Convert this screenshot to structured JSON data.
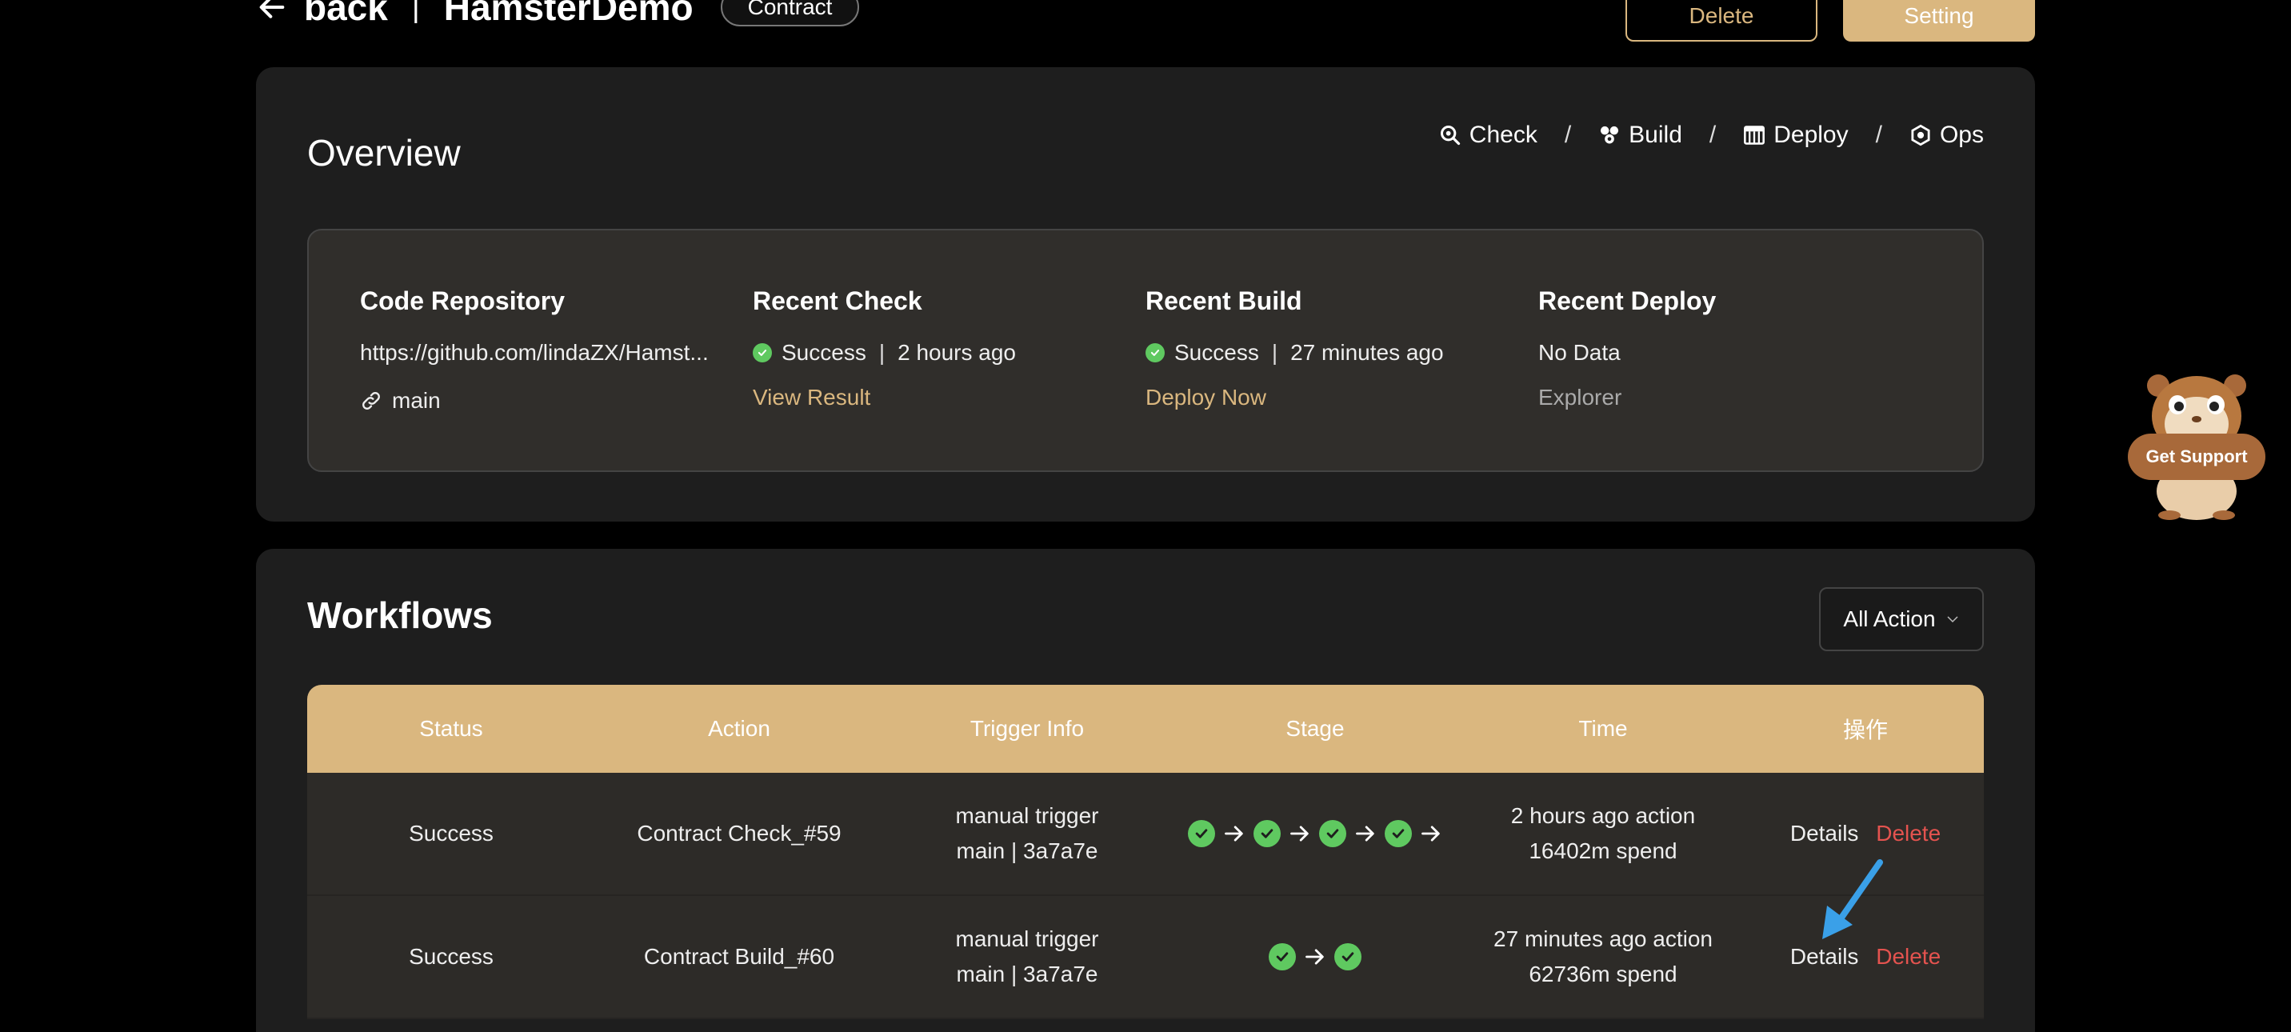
{
  "header": {
    "back_label": "back",
    "separator": "|",
    "project_name": "HamsterDemo",
    "project_type_tag": "Contract",
    "delete_label": "Delete",
    "setting_label": "Setting"
  },
  "overview": {
    "title": "Overview",
    "nav": [
      {
        "label": "Check",
        "icon": "search-icon"
      },
      {
        "label": "Build",
        "icon": "build-icon"
      },
      {
        "label": "Deploy",
        "icon": "deploy-icon"
      },
      {
        "label": "Ops",
        "icon": "ops-icon"
      }
    ],
    "nav_separator": "/",
    "code_repository": {
      "title": "Code Repository",
      "url": "https://github.com/lindaZX/Hamst...",
      "branch": "main"
    },
    "recent_check": {
      "title": "Recent Check",
      "status": "Success",
      "time": "2 hours ago",
      "link": "View Result"
    },
    "recent_build": {
      "title": "Recent Build",
      "status": "Success",
      "time": "27 minutes ago",
      "link": "Deploy Now"
    },
    "recent_deploy": {
      "title": "Recent Deploy",
      "status": "No Data",
      "link": "Explorer"
    },
    "divider": "|"
  },
  "workflows": {
    "title": "Workflows",
    "filter_value": "All Action",
    "columns": [
      "Status",
      "Action",
      "Trigger Info",
      "Stage",
      "Time",
      "操作"
    ],
    "rows": [
      {
        "status": "Success",
        "action": "Contract Check_#59",
        "trigger_line1": "manual trigger",
        "trigger_line2": "main | 3a7a7e",
        "stages_complete": 4,
        "time_line1": "2 hours ago action",
        "time_line2": "16402m spend",
        "details": "Details",
        "delete": "Delete"
      },
      {
        "status": "Success",
        "action": "Contract Build_#60",
        "trigger_line1": "manual trigger",
        "trigger_line2": "main | 3a7a7e",
        "stages_complete": 2,
        "time_line1": "27 minutes ago action",
        "time_line2": "62736m spend",
        "details": "Details",
        "delete": "Delete"
      }
    ]
  },
  "support": {
    "label": "Get Support"
  },
  "colors": {
    "accent": "#dab77f",
    "success": "#5fc960",
    "danger": "#e4534f",
    "pointer": "#3aa0e8"
  }
}
